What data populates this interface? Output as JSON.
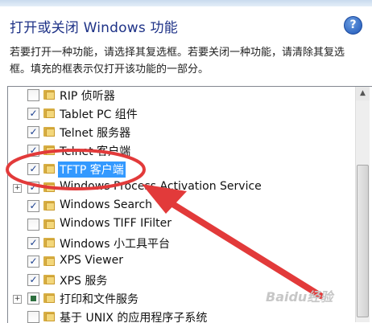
{
  "window": {
    "title": "打开或关闭 Windows 功能",
    "help_glyph": "?"
  },
  "description": "若要打开一种功能，请选择其复选框。若要关闭一种功能，请清除其复选框。填充的框表示仅打开该功能的一部分。",
  "features": [
    {
      "label": "RIP 侦听器",
      "state": "unchecked",
      "expandable": false
    },
    {
      "label": "Tablet PC 组件",
      "state": "checked",
      "expandable": false
    },
    {
      "label": "Telnet 服务器",
      "state": "checked",
      "expandable": false
    },
    {
      "label": "Telnet 客户端",
      "state": "checked",
      "expandable": false
    },
    {
      "label": "TFTP 客户端",
      "state": "checked",
      "expandable": false,
      "selected": true
    },
    {
      "label": "Windows Process Activation Service",
      "state": "checked",
      "expandable": true
    },
    {
      "label": "Windows Search",
      "state": "checked",
      "expandable": false
    },
    {
      "label": "Windows TIFF IFilter",
      "state": "unchecked",
      "expandable": false
    },
    {
      "label": "Windows 小工具平台",
      "state": "checked",
      "expandable": false
    },
    {
      "label": "XPS Viewer",
      "state": "checked",
      "expandable": false
    },
    {
      "label": "XPS 服务",
      "state": "checked",
      "expandable": false
    },
    {
      "label": "打印和文件服务",
      "state": "partial",
      "expandable": true
    },
    {
      "label": "基于 UNIX 的应用程序子系统",
      "state": "unchecked",
      "expandable": false
    }
  ],
  "check_glyph": "✓",
  "expand_glyph": "+",
  "scroll_up_glyph": "▲",
  "scroll_down_glyph": "▼",
  "watermark": "Baidu经验",
  "colors": {
    "title": "#1e3287",
    "selection": "#3399ff",
    "annotation": "#e23a3a"
  }
}
